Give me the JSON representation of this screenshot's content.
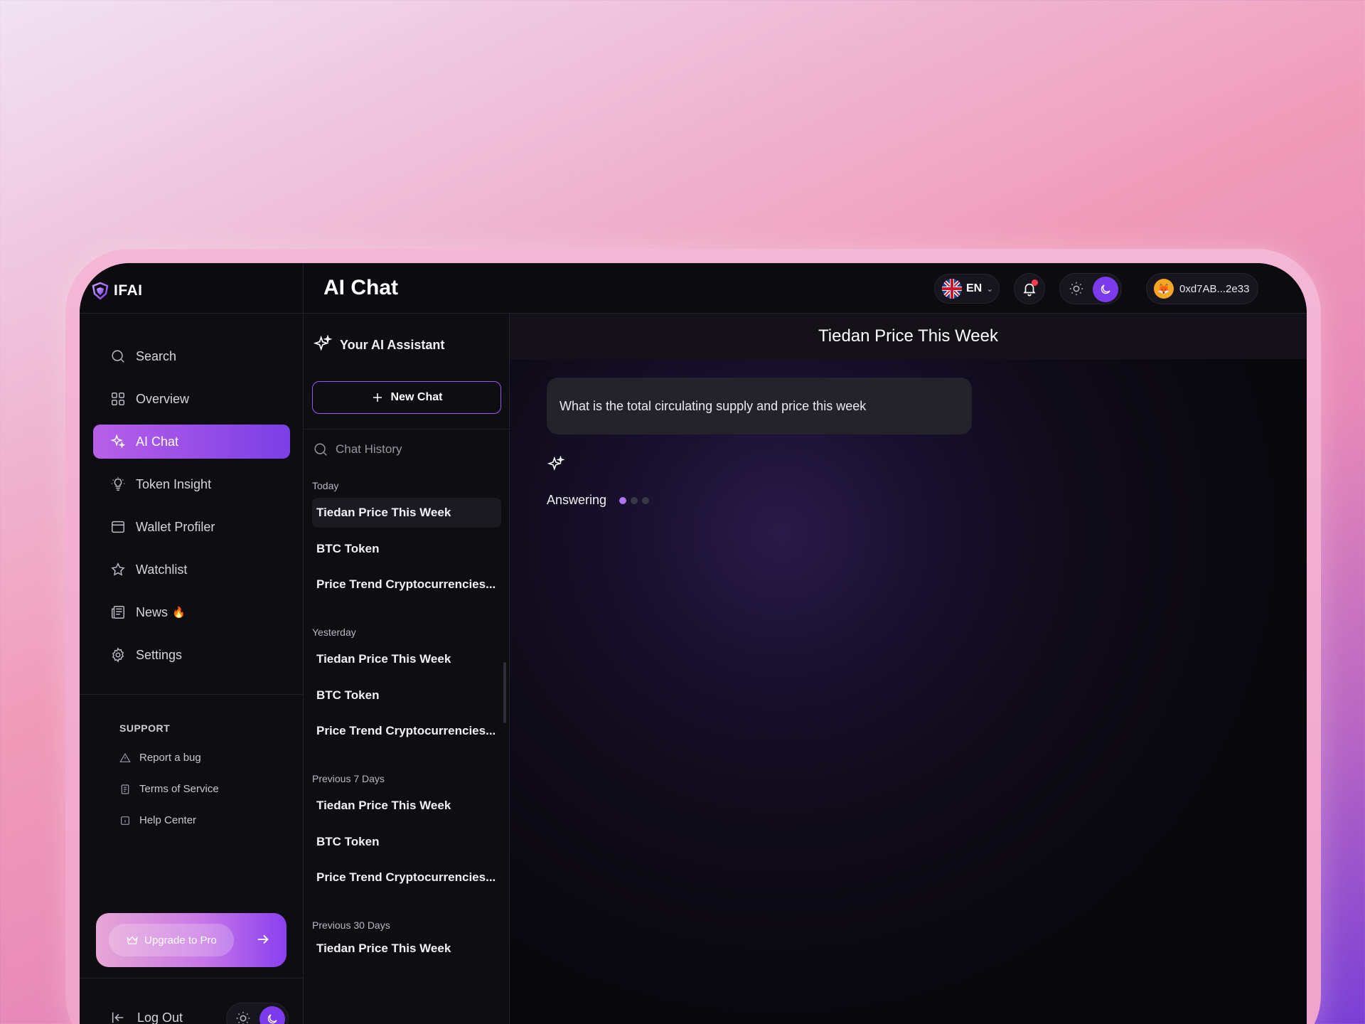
{
  "brand": {
    "name": "IFAI"
  },
  "header": {
    "page_title": "AI Chat",
    "language": "EN",
    "wallet_address": "0xd7AB...2e33"
  },
  "sidebar": {
    "items": [
      {
        "label": "Search",
        "icon": "search-icon"
      },
      {
        "label": "Overview",
        "icon": "grid-icon"
      },
      {
        "label": "AI Chat",
        "icon": "sparkle-icon",
        "active": true
      },
      {
        "label": "Token Insight",
        "icon": "lightbulb-icon"
      },
      {
        "label": "Wallet Profiler",
        "icon": "wallet-icon"
      },
      {
        "label": "Watchlist",
        "icon": "star-icon"
      },
      {
        "label": "News",
        "icon": "newspaper-icon",
        "badge": "🔥"
      },
      {
        "label": "Settings",
        "icon": "gear-icon"
      }
    ],
    "support": {
      "heading": "SUPPORT",
      "items": [
        {
          "label": "Report a bug",
          "icon": "warning-icon"
        },
        {
          "label": "Terms of Service",
          "icon": "document-icon"
        },
        {
          "label": "Help Center",
          "icon": "info-icon"
        }
      ]
    },
    "upgrade_label": "Upgrade to Pro",
    "logout_label": "Log Out"
  },
  "chat_list": {
    "assistant_title": "Your AI Assistant",
    "new_chat_label": "New Chat",
    "search_placeholder": "Chat History",
    "groups": [
      {
        "label": "Today",
        "items": [
          "Tiedan Price This Week",
          "BTC Token",
          "Price Trend Cryptocurrencies..."
        ]
      },
      {
        "label": "Yesterday",
        "items": [
          "Tiedan Price This Week",
          "BTC Token",
          "Price Trend Cryptocurrencies..."
        ]
      },
      {
        "label": "Previous 7 Days",
        "items": [
          "Tiedan Price This Week",
          "BTC Token",
          "Price Trend Cryptocurrencies..."
        ]
      },
      {
        "label": "Previous 30 Days",
        "items": [
          "Tiedan Price This Week"
        ]
      }
    ]
  },
  "conversation": {
    "title": "Tiedan Price This Week",
    "user_message": "What is the total circulating supply and price this week",
    "status": "Answering"
  },
  "colors": {
    "accent": "#7c3aed",
    "active_gradient_start": "#b85fe8",
    "active_gradient_end": "#7a3fe6",
    "notification_dot": "#ff3b4d"
  }
}
